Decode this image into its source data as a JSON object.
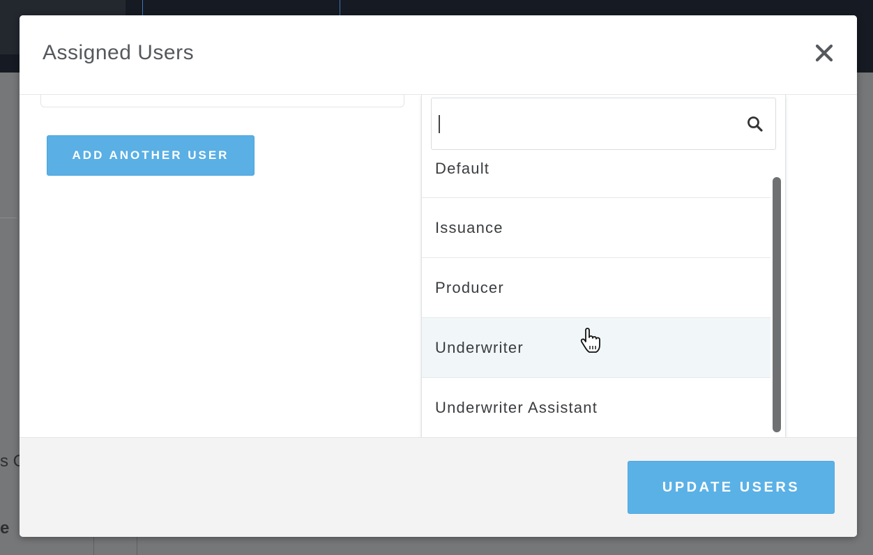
{
  "modal": {
    "title": "Assigned Users",
    "close_icon": "close-icon"
  },
  "body": {
    "add_user_label": "ADD ANOTHER USER"
  },
  "dropdown": {
    "search_placeholder": "",
    "search_value": "",
    "search_icon": "search-icon",
    "options": [
      {
        "label": "Default"
      },
      {
        "label": "Issuance"
      },
      {
        "label": "Producer"
      },
      {
        "label": "Underwriter",
        "hovered": true
      },
      {
        "label": "Underwriter Assistant"
      }
    ]
  },
  "footer": {
    "update_label": "UPDATE USERS"
  },
  "background": {
    "partial_text_1": "s C",
    "partial_text_2": "e"
  },
  "colors": {
    "accent_button": "#5aafe4",
    "hover_row": "#f1f6f9",
    "overlay": "#767779"
  }
}
